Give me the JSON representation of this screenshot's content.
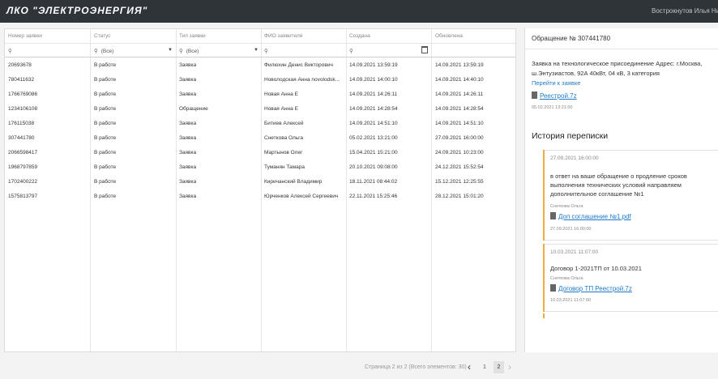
{
  "header": {
    "title": "ЛКО \"ЭЛЕКТРОЭНЕРГИЯ\"",
    "user": "Вострокнутов Илья Ни"
  },
  "grid": {
    "columns": [
      "Номер заявки",
      "Статус",
      "Тип заявки",
      "ФИО заявителя",
      "Создана",
      "Обновлена"
    ],
    "filters": {
      "status": "(Все)",
      "type": "(Все)"
    },
    "rows": [
      [
        "20693678",
        "В работе",
        "Заявка",
        "Филюхин Денис Викторович",
        "14.09.2021 13:59:19",
        "14.09.2021 13:59:19"
      ],
      [
        "780411632",
        "В работе",
        "Заявка",
        "Новолодская Анна novolodsk...",
        "14.09.2021 14:00:10",
        "14.09.2021 14:40:10"
      ],
      [
        "1766769086",
        "В работе",
        "Заявка",
        "Новая Анна Е",
        "14.09.2021 14:26:11",
        "14.09.2021 14:26:11"
      ],
      [
        "1234106108",
        "В работе",
        "Обращение",
        "Новая Анна Е",
        "14.09.2021 14:28:54",
        "14.09.2021 14:28:54"
      ],
      [
        "176115038",
        "В работе",
        "Заявка",
        "Битиев Алексей",
        "14.09.2021 14:51:10",
        "14.09.2021 14:51:10"
      ],
      [
        "307441780",
        "В работе",
        "Заявка",
        "Снеткова Ольга",
        "05.02.2021 13:21:00",
        "27.09.2021 16:00:00"
      ],
      [
        "2066598417",
        "В работе",
        "Заявка",
        "Мартынов Олег",
        "15.04.2021 15:21:00",
        "24.09.2021 10:23:00"
      ],
      [
        "1968797859",
        "В работе",
        "Заявка",
        "Туманян Тамара",
        "20.10.2021 09:08:00",
        "24.12.2021 15:52:54"
      ],
      [
        "1702400222",
        "В работе",
        "Заявка",
        "Киричанский Владимир",
        "18.11.2021 08:44:02",
        "15.12.2021 12:25:55"
      ],
      [
        "1575813797",
        "В работе",
        "Заявка",
        "Юрченков Алексей Сергеевич",
        "22.11.2021 15:25:46",
        "28.12.2021 15:01:20"
      ]
    ]
  },
  "pager": {
    "info": "Страница 2 из 2 (Всего элементов: 30)",
    "page1": "1",
    "page2": "2"
  },
  "side": {
    "title": "Обращение № 307441780",
    "description": "Заявка на технологическое присоединение Адрес: г.Москва, ш.Энтузиастов, 92А 40кВт, 04 кВ, 3 категория",
    "goto_link": "Перейти к заявке",
    "file": "Реестрой.7z",
    "file_date": "05.02.2021 13:21:00",
    "history_title": "История переписки",
    "messages": [
      {
        "date": "27.09.2021 16:00:00",
        "text": "в ответ на ваше обращение о продление сроков выполнения технических условий направляем дополнительное соглашение №1",
        "author": "Снеткова Ольга",
        "file": "Доп соглашение №1.pdf",
        "file_date": "27.09.2021 16:00:00"
      },
      {
        "date": "10.03.2021 11:07:00",
        "text": "Договор 1-2021ТП от 10.03.2021",
        "author": "Снеткова Ольга",
        "file": "Договор ТП Реестрой.7z",
        "file_date": "10.03.2021 11:07:00"
      }
    ]
  }
}
